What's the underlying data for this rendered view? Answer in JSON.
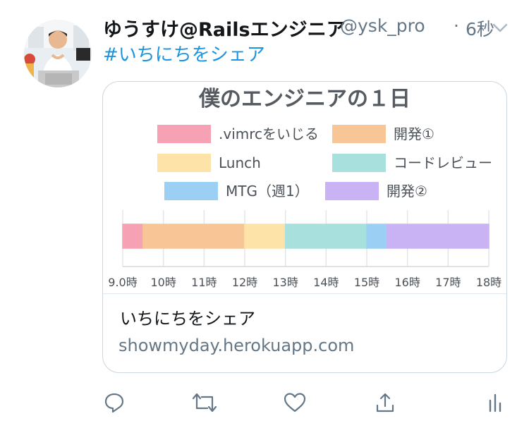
{
  "tweet": {
    "author_name": "ゆうすけ@Railsエンジニア",
    "handle": "@ysk_pro",
    "separator": "·",
    "time": "6秒",
    "hashtag": "#いちにちをシェア"
  },
  "card": {
    "title": "いちにちをシェア",
    "domain": "showmyday.herokuapp.com",
    "chart_data": {
      "type": "bar",
      "title": "僕のエンジニアの１日",
      "legend": [
        {
          "name": ".vimrcをいじる",
          "color": "#f7a1b4"
        },
        {
          "name": "開発①",
          "color": "#f8c597"
        },
        {
          "name": "Lunch",
          "color": "#fde3a8"
        },
        {
          "name": "コードレビュー",
          "color": "#a8e0de"
        },
        {
          "name": "MTG（週1）",
          "color": "#9ccff4"
        },
        {
          "name": "開発②",
          "color": "#c9b3f5"
        }
      ],
      "segments": [
        {
          "name": ".vimrcをいじる",
          "start": 9.0,
          "end": 9.5
        },
        {
          "name": "開発①",
          "start": 9.5,
          "end": 12.0
        },
        {
          "name": "Lunch",
          "start": 12.0,
          "end": 13.0
        },
        {
          "name": "コードレビュー",
          "start": 13.0,
          "end": 15.0
        },
        {
          "name": "MTG（週1）",
          "start": 15.0,
          "end": 15.5
        },
        {
          "name": "開発②",
          "start": 15.5,
          "end": 18.0
        }
      ],
      "x_ticks": [
        "9.0時",
        "10時",
        "11時",
        "12時",
        "13時",
        "14時",
        "15時",
        "16時",
        "17時",
        "18時"
      ],
      "xlim": [
        9,
        18
      ],
      "grid": true
    }
  },
  "actions": [
    {
      "name": "reply",
      "icon": "reply-icon"
    },
    {
      "name": "retweet",
      "icon": "retweet-icon"
    },
    {
      "name": "like",
      "icon": "heart-icon"
    },
    {
      "name": "share",
      "icon": "share-icon"
    },
    {
      "name": "analytics",
      "icon": "analytics-icon"
    }
  ],
  "colors": {
    "link": "#1b95e0",
    "muted": "#657786",
    "icon": "#657786",
    "border": "#ccd6dd"
  }
}
